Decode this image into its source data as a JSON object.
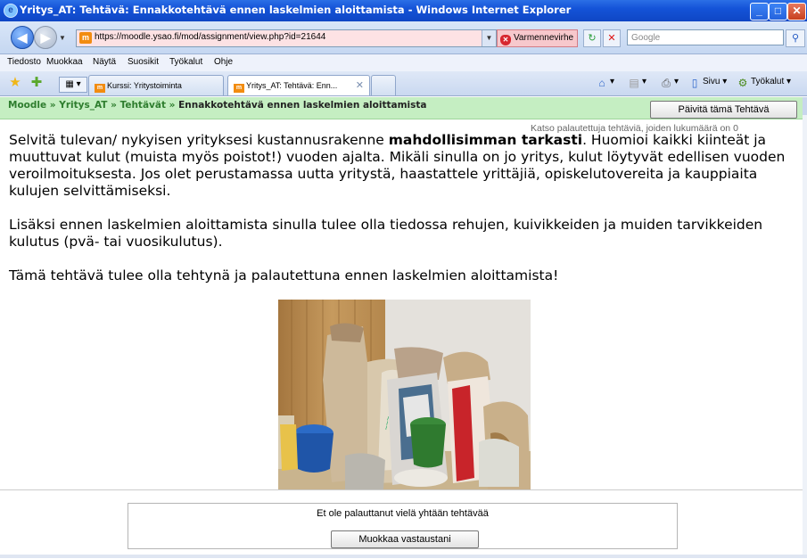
{
  "window": {
    "title": "Yritys_AT: Tehtävä: Ennakkotehtävä ennen laskelmien aloittamista - Windows Internet Explorer",
    "controls": [
      "_",
      "□",
      "✕"
    ]
  },
  "address_bar": {
    "url": "https://moodle.ysao.fi/mod/assignment/view.php?id=21644",
    "cert_error": "Varmennevirhe",
    "search_placeholder": "Google"
  },
  "menu": {
    "items": [
      "Tiedosto",
      "Muokkaa",
      "Näytä",
      "Suosikit",
      "Työkalut",
      "Ohje"
    ]
  },
  "tabs": [
    {
      "label": "Kurssi: Yritystoiminta",
      "active": false
    },
    {
      "label": "Yritys_AT: Tehtävä: Enn...",
      "active": true
    }
  ],
  "command_bar": {
    "page": "Sivu",
    "tools": "Työkalut"
  },
  "breadcrumb": {
    "items": [
      "Moodle",
      "Yritys_AT",
      "Tehtävät"
    ],
    "separator": "»",
    "current": "Ennakkotehtävä ennen laskelmien aloittamista"
  },
  "update_button": "Päivitä tämä Tehtävä",
  "submitted_link": "Katso palautettuja tehtäviä, joiden lukumäärä on 0",
  "assignment": {
    "p1_before": "Selvitä tulevan/ nykyisen yrityksesi kustannusrakenne ",
    "p1_bold": "mahdollisimman tarkasti",
    "p1_after": ". Huomioi kaikki kiinteät ja muuttuvat kulut (muista myös poistot!) vuoden ajalta. Mikäli sinulla on jo yritys, kulut löytyvät edellisen vuoden veroilmoituksesta. Jos olet perustamassa uutta yritystä, haastattele yrittäjiä, opiskelutovereita ja kauppiaita kulujen selvittämiseksi.",
    "p2": "Lisäksi ennen laskelmien aloittamista sinulla tulee olla tiedossa rehujen, kuivikkeiden ja muiden tarvikkeiden kulutus (pvä- tai vuosikulutus).",
    "p3": "Tämä tehtävä tulee olla tehtynä ja palautettuna ennen laskelmien aloittamista!"
  },
  "feedback": {
    "status": "Et ole palauttanut vielä yhtään tehtävää",
    "edit_button": "Muokkaa vastaustani"
  }
}
